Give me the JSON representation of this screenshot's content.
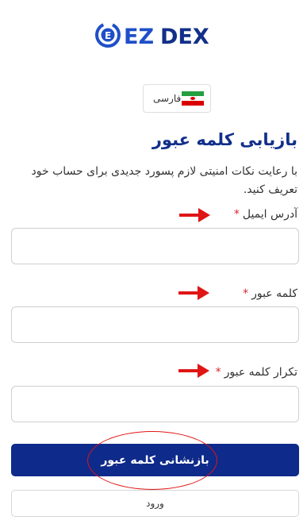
{
  "brand": {
    "logo_name": "EZDEX"
  },
  "language": {
    "label": "فارسی",
    "icon": "iran-flag-icon"
  },
  "page": {
    "title": "بازیابی کلمه عبور",
    "description": "با رعایت نکات امنیتی لازم پسورد جدیدی برای حساب خود تعریف کنید."
  },
  "form": {
    "fields": [
      {
        "label": "آدرس ایمیل",
        "required_mark": "*",
        "value": "",
        "placeholder": ""
      },
      {
        "label": "کلمه عبور",
        "required_mark": "*",
        "value": "",
        "placeholder": ""
      },
      {
        "label": "تکرار کلمه عبور",
        "required_mark": "*",
        "value": "",
        "placeholder": ""
      }
    ],
    "submit_label": "بازنشانی کلمه عبور",
    "login_label": "ورود"
  },
  "colors": {
    "accent": "#0e2a8a",
    "annotation": "#e01515",
    "required": "#d9262e"
  }
}
